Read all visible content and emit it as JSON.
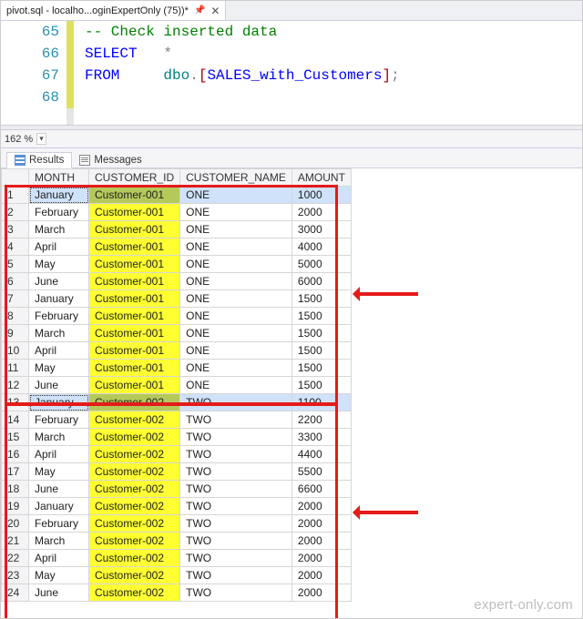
{
  "tab": {
    "title": "pivot.sql - localho...oginExpertOnly (75))*"
  },
  "editor": {
    "lines": [
      {
        "n": 65,
        "kind": "comment",
        "text": "-- Check inserted data"
      },
      {
        "n": 66,
        "kind": "select",
        "kw": "SELECT",
        "rest": "*"
      },
      {
        "n": 67,
        "kind": "from",
        "kw": "FROM",
        "schema": "dbo",
        "dot": ".",
        "br_l": "[",
        "obj": "SALES_with_Customers",
        "br_r": "]",
        "semi": ";"
      },
      {
        "n": 68,
        "kind": "blank"
      }
    ]
  },
  "zoom": "162 %",
  "result_tabs": {
    "results": "Results",
    "messages": "Messages"
  },
  "grid": {
    "headers": {
      "rownum": "",
      "month": "MONTH",
      "customer_id": "CUSTOMER_ID",
      "customer_name": "CUSTOMER_NAME",
      "amount": "AMOUNT"
    },
    "rows": [
      {
        "n": 1,
        "month": "January",
        "cid": "Customer-001",
        "cname": "ONE",
        "amt": "1000",
        "sel": true
      },
      {
        "n": 2,
        "month": "February",
        "cid": "Customer-001",
        "cname": "ONE",
        "amt": "2000"
      },
      {
        "n": 3,
        "month": "March",
        "cid": "Customer-001",
        "cname": "ONE",
        "amt": "3000"
      },
      {
        "n": 4,
        "month": "April",
        "cid": "Customer-001",
        "cname": "ONE",
        "amt": "4000"
      },
      {
        "n": 5,
        "month": "May",
        "cid": "Customer-001",
        "cname": "ONE",
        "amt": "5000"
      },
      {
        "n": 6,
        "month": "June",
        "cid": "Customer-001",
        "cname": "ONE",
        "amt": "6000"
      },
      {
        "n": 7,
        "month": "January",
        "cid": "Customer-001",
        "cname": "ONE",
        "amt": "1500"
      },
      {
        "n": 8,
        "month": "February",
        "cid": "Customer-001",
        "cname": "ONE",
        "amt": "1500"
      },
      {
        "n": 9,
        "month": "March",
        "cid": "Customer-001",
        "cname": "ONE",
        "amt": "1500"
      },
      {
        "n": 10,
        "month": "April",
        "cid": "Customer-001",
        "cname": "ONE",
        "amt": "1500"
      },
      {
        "n": 11,
        "month": "May",
        "cid": "Customer-001",
        "cname": "ONE",
        "amt": "1500"
      },
      {
        "n": 12,
        "month": "June",
        "cid": "Customer-001",
        "cname": "ONE",
        "amt": "1500"
      },
      {
        "n": 13,
        "month": "January",
        "cid": "Customer-002",
        "cname": "TWO",
        "amt": "1100",
        "sel": true
      },
      {
        "n": 14,
        "month": "February",
        "cid": "Customer-002",
        "cname": "TWO",
        "amt": "2200"
      },
      {
        "n": 15,
        "month": "March",
        "cid": "Customer-002",
        "cname": "TWO",
        "amt": "3300"
      },
      {
        "n": 16,
        "month": "April",
        "cid": "Customer-002",
        "cname": "TWO",
        "amt": "4400"
      },
      {
        "n": 17,
        "month": "May",
        "cid": "Customer-002",
        "cname": "TWO",
        "amt": "5500"
      },
      {
        "n": 18,
        "month": "June",
        "cid": "Customer-002",
        "cname": "TWO",
        "amt": "6600"
      },
      {
        "n": 19,
        "month": "January",
        "cid": "Customer-002",
        "cname": "TWO",
        "amt": "2000"
      },
      {
        "n": 20,
        "month": "February",
        "cid": "Customer-002",
        "cname": "TWO",
        "amt": "2000"
      },
      {
        "n": 21,
        "month": "March",
        "cid": "Customer-002",
        "cname": "TWO",
        "amt": "2000"
      },
      {
        "n": 22,
        "month": "April",
        "cid": "Customer-002",
        "cname": "TWO",
        "amt": "2000"
      },
      {
        "n": 23,
        "month": "May",
        "cid": "Customer-002",
        "cname": "TWO",
        "amt": "2000"
      },
      {
        "n": 24,
        "month": "June",
        "cid": "Customer-002",
        "cname": "TWO",
        "amt": "2000"
      }
    ]
  },
  "watermark": "expert-only.com"
}
